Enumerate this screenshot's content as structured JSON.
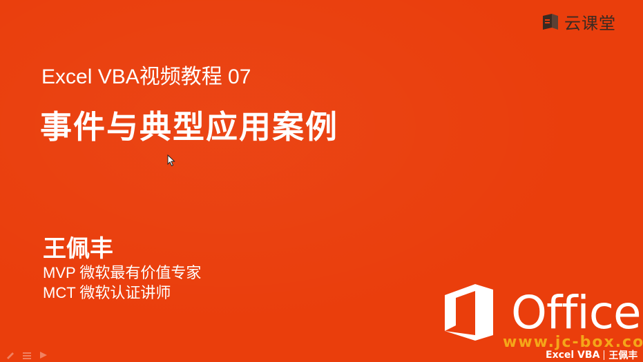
{
  "brand": {
    "icon": "book-logo-icon",
    "name": "云课堂"
  },
  "slide": {
    "subtitle": "Excel VBA视频教程 07",
    "title": "事件与典型应用案例",
    "presenter": {
      "name": "王佩丰",
      "line1": "MVP 微软最有价值专家",
      "line2": "MCT 微软认证讲师"
    }
  },
  "office": {
    "icon": "office-logo-icon",
    "label": "Office"
  },
  "watermark": {
    "text": "www.jc-box.com"
  },
  "footer": {
    "left": "Excel VBA",
    "right": "王佩丰"
  },
  "controls": [
    "pen-icon",
    "menu-icon",
    "next-icon"
  ],
  "colors": {
    "background": "#ea3e0c",
    "watermark": "#f7b21b",
    "brand_text": "#3a2a22"
  }
}
